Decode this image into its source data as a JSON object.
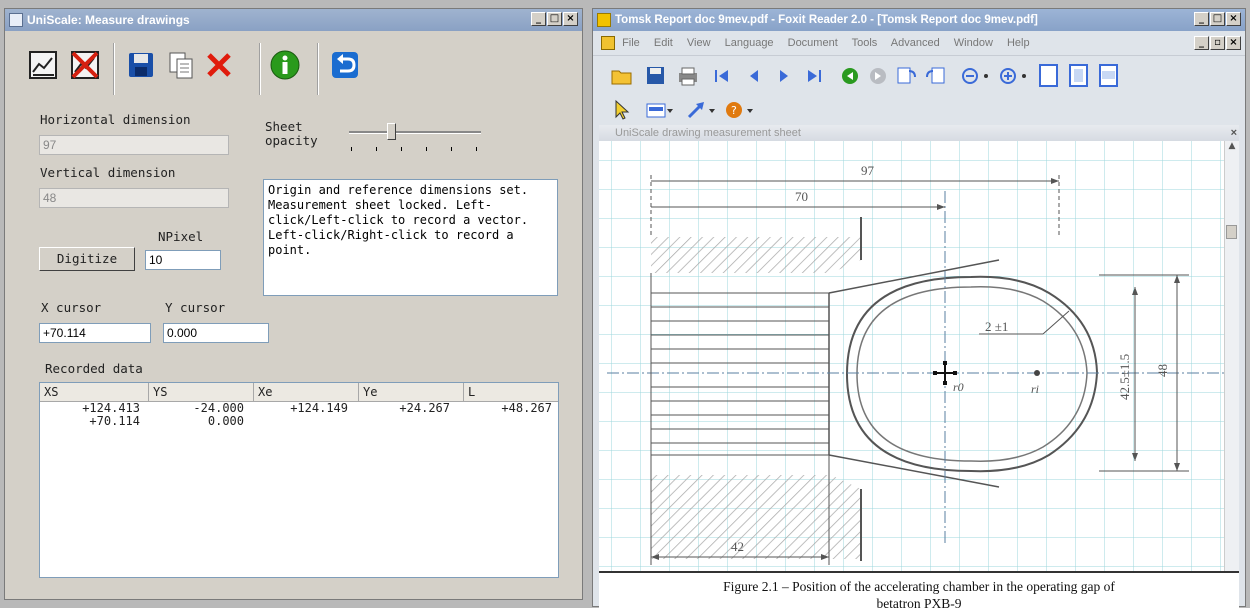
{
  "uniscale": {
    "title": "UniScale: Measure drawings",
    "controls": {
      "min": "_",
      "max": "□",
      "close": "×"
    },
    "horizontal_label": "Horizontal dimension",
    "horizontal_value": "97",
    "vertical_label": "Vertical dimension",
    "vertical_value": "48",
    "sheet_opacity_label_1": "Sheet",
    "sheet_opacity_label_2": "opacity",
    "sheet_opacity_level": 0.3,
    "message": "Origin and reference dimensions set. Measurement sheet locked. Left-click/Left-click to record a vector. Left-click/Right-click to record a point.",
    "npixel_label": "NPixel",
    "npixel_value": "10",
    "digitize_label": "Digitize",
    "xcursor_label": "X cursor",
    "xcursor_value": "+70.114",
    "ycursor_label": "Y cursor",
    "ycursor_value": "0.000",
    "recorded_label": "Recorded data",
    "columns": [
      "XS",
      "YS",
      "Xe",
      "Ye",
      "L"
    ],
    "rows": [
      [
        "+124.413",
        "-24.000",
        "+124.149",
        "+24.267",
        "+48.267"
      ],
      [
        "+70.114",
        "0.000",
        "",
        "",
        ""
      ]
    ]
  },
  "foxit": {
    "title": "Tomsk Report doc 9mev.pdf - Foxit Reader 2.0 - [Tomsk Report doc 9mev.pdf]",
    "menu": [
      "File",
      "Edit",
      "View",
      "Language",
      "Document",
      "Tools",
      "Advanced",
      "Window",
      "Help"
    ],
    "controls": {
      "min": "_",
      "max": "□",
      "close": "×"
    },
    "doc_controls": {
      "min": "_",
      "restore": "▫",
      "close": "×"
    },
    "overlay_title": "UniScale drawing measurement sheet",
    "dim_97": "97",
    "dim_70": "70",
    "dim_42": "42",
    "dim_48": "48",
    "dim_425": "42.5±1.5",
    "dim_2": "2 ±1",
    "r0": "r0",
    "ri": "ri",
    "caption_1": "Figure 2.1 – Position of the accelerating chamber in the operating gap of",
    "caption_2": "betatron PXB-9"
  }
}
